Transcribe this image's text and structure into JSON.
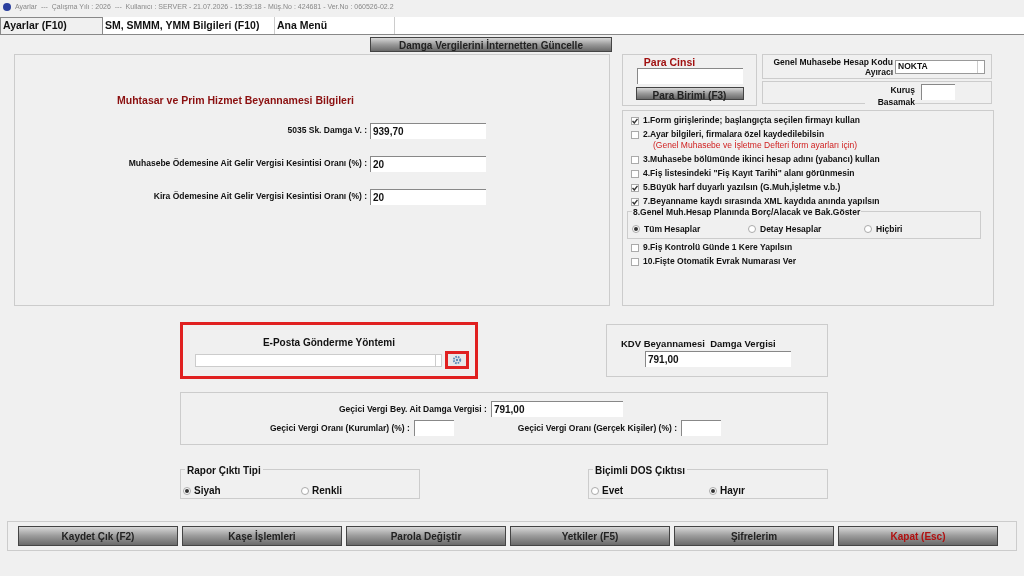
{
  "window": {
    "title": "Ayarlar  ---  Çalışma Yılı : 2026  ---  Kullanıcı : SERVER - 21.07.2026 - 15:39:18 - Müş.No : 424681 - Ver.No : 060526-02.2"
  },
  "tabs": [
    {
      "label": "Ayarlar (F10)",
      "selected": true
    },
    {
      "label": "SM, SMMM, YMM Bilgileri (F10)",
      "selected": false
    },
    {
      "label": "Ana Menü",
      "selected": false
    }
  ],
  "update_button": "Damga Vergilerini İnternetten Güncelle",
  "muhtasar": {
    "title": "Muhtasar ve Prim Hizmet Beyannamesi Bilgileri",
    "fields": [
      {
        "label": "5035 Sk. Damga V. :",
        "value": "939,70"
      },
      {
        "label": "Muhasebe Ödemesine Ait Gelir Vergisi Kesintisi Oranı (%) :",
        "value": "20"
      },
      {
        "label": "Kira Ödemesine Ait Gelir Vergisi Kesintisi Oranı (%) :",
        "value": "20"
      }
    ]
  },
  "currency": {
    "title": "Para Cinsi",
    "button": "Para Birimi (F3)"
  },
  "account_separator": {
    "label": "Genel Muhasebe Hesap Kodu Ayıracı",
    "value": "NOKTA"
  },
  "kurus": {
    "label": "Kuruş Basamak"
  },
  "options": [
    {
      "kind": "check",
      "label": "1.Form girişlerinde; başlangıçta seçilen firmayı kullan",
      "checked": true
    },
    {
      "kind": "check",
      "label": "2.Ayar bilgileri, firmalara özel kaydedilebilsin",
      "note": "(Genel Muhasebe ve İşletme Defteri form ayarları için)",
      "checked": false
    },
    {
      "kind": "check",
      "label": "3.Muhasebe bölümünde ikinci hesap adını (yabancı) kullan",
      "checked": false
    },
    {
      "kind": "check",
      "label": "4.Fiş listesindeki \"Fiş Kayıt Tarihi\" alanı görünmesin",
      "checked": false
    },
    {
      "kind": "check",
      "label": "5.Büyük harf duyarlı yazılsın (G.Muh,İşletme v.b.)",
      "checked": true
    },
    {
      "kind": "check",
      "label": "7.Beyanname kaydı sırasında XML kaydıda anında yapılsın",
      "checked": true
    },
    {
      "kind": "radio_group",
      "label": "8.Genel Muh.Hesap Planında Borç/Alacak ve Bak.Göster",
      "options": [
        {
          "label": "Tüm Hesaplar",
          "selected": true
        },
        {
          "label": "Detay Hesaplar",
          "selected": false
        },
        {
          "label": "Hiçbiri",
          "selected": false
        }
      ]
    },
    {
      "kind": "check",
      "label": "9.Fiş Kontrolü Günde 1 Kere Yapılsın",
      "checked": false
    },
    {
      "kind": "check",
      "label": "10.Fişte Otomatik Evrak Numarası Ver",
      "checked": false
    }
  ],
  "email": {
    "title": "E-Posta Gönderme Yöntemi"
  },
  "kdv": {
    "title": "KDV Beyannamesi  Damga Vergisi",
    "value": "791,00"
  },
  "gecici": {
    "damga_label": "Geçici Vergi Bey. Ait Damga Vergisi :",
    "damga_value": "791,00",
    "kurumlar_label": "Geçici Vergi Oranı (Kurumlar) (%) :",
    "gercek_label": "Geçici Vergi Oranı (Gerçek Kişiler) (%) :"
  },
  "report_type": {
    "title": "Rapor Çıktı Tipi",
    "options": [
      {
        "label": "Siyah",
        "selected": true
      },
      {
        "label": "Renkli",
        "selected": false
      }
    ]
  },
  "dos_output": {
    "title": "Biçimli DOS Çıktısı",
    "options": [
      {
        "label": "Evet",
        "selected": false
      },
      {
        "label": "Hayır",
        "selected": true
      }
    ]
  },
  "buttons": [
    {
      "label": "Kaydet Çık (F2)",
      "kind": "normal"
    },
    {
      "label": "Kaşe İşlemleri",
      "kind": "normal"
    },
    {
      "label": "Parola Değiştir",
      "kind": "normal"
    },
    {
      "label": "Yetkiler (F5)",
      "kind": "normal"
    },
    {
      "label": "Şifrelerim",
      "kind": "normal"
    },
    {
      "label": "Kapat (Esc)",
      "kind": "danger"
    }
  ]
}
